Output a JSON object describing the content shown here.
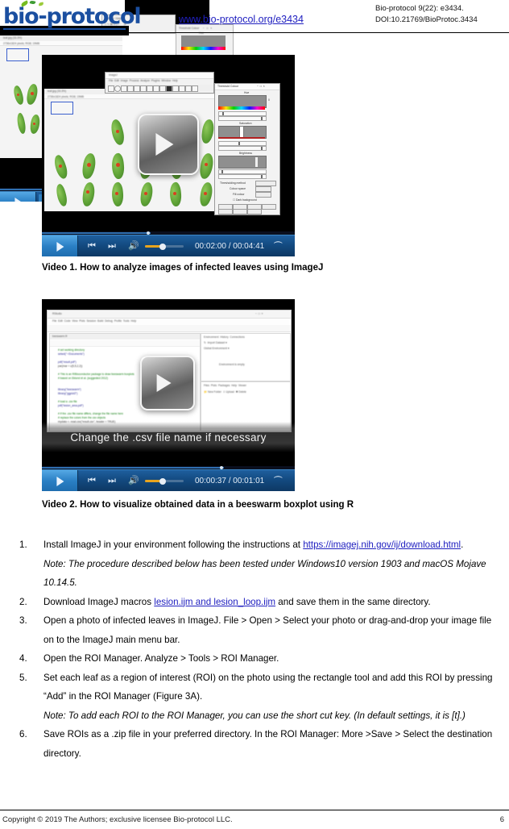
{
  "header": {
    "logo_text": "bio-protocol",
    "url": "www.bio-protocol.org/e3434",
    "citation_line1": "Bio-protocol 9(22): e3434.",
    "citation_line2": "DOI:10.21769/BioProtoc.3434"
  },
  "video1": {
    "caption": "Video 1. How to analyze images of infected leaves using ImageJ",
    "current_time": "00:02:00",
    "total_time": "00:04:41",
    "time_display": "00:02:00 / 00:04:41",
    "progress_percent": 43,
    "volume_percent": 55,
    "play_label": "play-button",
    "thumbnail_description": "ImageJ window showing photo of infected leaves with red lesions, ImageJ main menu bar and Threshold Color dialog",
    "threshold_dialog_title": "Threshold Color",
    "threshold_sections": [
      "Hue",
      "Saturation",
      "Brightness"
    ],
    "threshold_fields": [
      "Thresholding method",
      "Colour space",
      "Fill colour"
    ],
    "threshold_checkbox": "Dark background",
    "threshold_buttons": [
      "Original",
      "Filtered",
      "Select",
      "Sample",
      "Stack",
      "Macro",
      "Help"
    ]
  },
  "video2": {
    "caption": "Video 2. How to visualize obtained data in a beeswarm boxplot using R",
    "current_time": "00:00:37",
    "total_time": "00:01:01",
    "time_display": "00:00:37 / 00:01:01",
    "progress_percent": 72,
    "volume_percent": 55,
    "subtitle": "Change the .csv file name if necessary",
    "play_label": "play-button",
    "thumbnail_description": "RStudio window with R script editor, console, environment and files panes"
  },
  "steps": [
    {
      "number": "1.",
      "text_before": "Install ImageJ in your environment following the instructions at ",
      "link": "https://imagej.nih.gov/ij/download.html",
      "text_after": ".",
      "note": "Note: The procedure described below has been tested under Windows10 version 1903 and macOS Mojave 10.14.5."
    },
    {
      "number": "2.",
      "text_before": "Download ImageJ macros ",
      "link": "lesion.ijm and lesion_loop.ijm",
      "text_after": " and save them in the same directory.",
      "note": ""
    },
    {
      "number": "3.",
      "text_before": "Open a photo of infected leaves in ImageJ. File > Open > Select your photo or drag-and-drop your image file on to the ImageJ main menu bar.",
      "link": "",
      "text_after": "",
      "note": ""
    },
    {
      "number": "4.",
      "text_before": "Open the ROI Manager. Analyze > Tools > ROI Manager.",
      "link": "",
      "text_after": "",
      "note": ""
    },
    {
      "number": "5.",
      "text_before": "Set each leaf as a region of interest (ROI) on the photo using the rectangle tool and add this ROI by pressing “Add” in the ROI Manager (Figure 3A).",
      "link": "",
      "text_after": "",
      "note": "Note: To add each ROI to the ROI Manager, you can use the short cut key. (In default settings, it is [t].)"
    },
    {
      "number": "6.",
      "text_before": "Save ROIs as a .zip file in your preferred directory. In the ROI Manager: More >Save > Select the destination directory.",
      "link": "",
      "text_after": "",
      "note": ""
    }
  ],
  "footer": {
    "copyright": "Copyright © 2019 The Authors; exclusive licensee Bio-protocol LLC.",
    "page_number": "6"
  },
  "colors": {
    "link": "#2020c0",
    "logo_blue": "#1b4fa0",
    "leaf_green": "#76bc21",
    "player_blue": "#2a7fc4",
    "volume_orange": "#e8a41e"
  }
}
